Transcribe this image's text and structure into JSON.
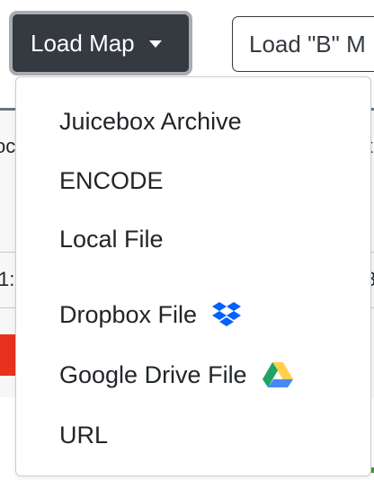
{
  "toolbar": {
    "load_map_label": "Load Map",
    "load_b_label": "Load \"B\" M"
  },
  "background": {
    "fragment_left_top": "oc",
    "fragment_right_top": "x",
    "fragment_left_mid": "1:",
    "fragment_right_mid": "8"
  },
  "menu": {
    "items": [
      {
        "label": "Juicebox Archive",
        "icon": ""
      },
      {
        "label": "ENCODE",
        "icon": ""
      },
      {
        "label": "Local File",
        "icon": ""
      },
      {
        "label": "Dropbox File",
        "icon": "dropbox-icon"
      },
      {
        "label": "Google Drive File",
        "icon": "google-drive-icon"
      },
      {
        "label": "URL",
        "icon": ""
      }
    ]
  },
  "colors": {
    "primary_dark": "#343a40",
    "dropbox_blue": "#0061fe",
    "drive_green": "#1fa463",
    "drive_yellow": "#ffd04b",
    "drive_blue": "#4688f4"
  }
}
